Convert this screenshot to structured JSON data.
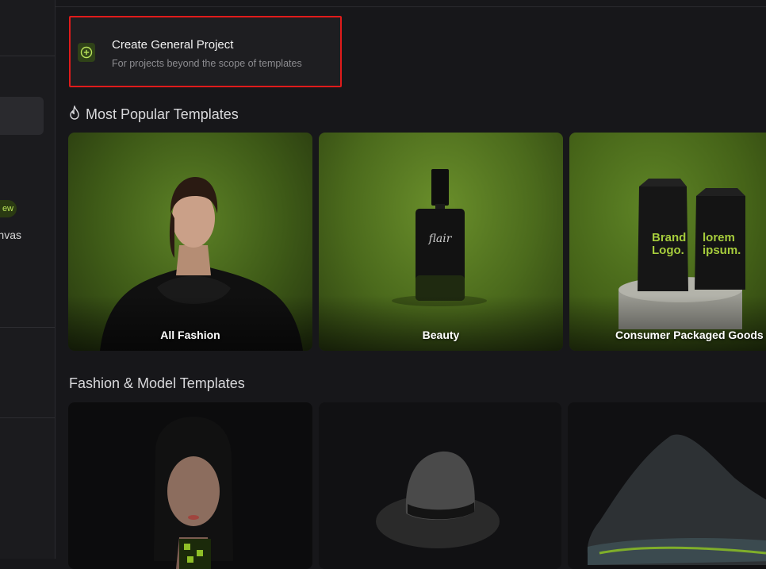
{
  "sidebar": {
    "badge_label": "ew",
    "item_text": "nvas"
  },
  "create_project": {
    "title": "Create General Project",
    "subtitle": "For projects beyond the scope of templates"
  },
  "popular": {
    "title": "Most Popular Templates",
    "cards": [
      {
        "label": "All Fashion"
      },
      {
        "label": "Beauty"
      },
      {
        "label": "Consumer Packaged Goods"
      }
    ]
  },
  "fashion": {
    "title": "Fashion & Model Templates"
  },
  "product_art": {
    "bottle_brand": "flair",
    "bag_left": "Brand\nLogo.",
    "bag_right": "lorem\nipsum."
  },
  "colors": {
    "accent": "#b9e35a",
    "highlight": "#e01b1b",
    "background": "#17171a"
  }
}
